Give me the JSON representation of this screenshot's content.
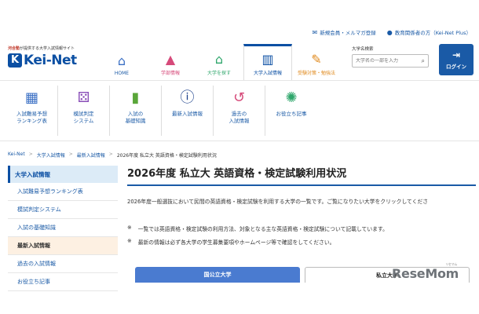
{
  "top_links": {
    "register": "新規会員・メルマガ登録",
    "staff": "教育関係者の方（Kei-Net Plus）"
  },
  "logo": {
    "tagline_brand": "河合塾",
    "tagline_rest": "が提供する大学入試情報サイト",
    "name": "Kei-Net",
    "mark": "K"
  },
  "main_nav": [
    {
      "label": "HOME",
      "icon": "home-icon",
      "color": "#3a6fc4"
    },
    {
      "label": "学部情報",
      "icon": "graduation-cap-icon",
      "color": "#d64a7a"
    },
    {
      "label": "大学を探す",
      "icon": "school-search-icon",
      "color": "#2ea66b"
    },
    {
      "label": "大学入試情報",
      "icon": "bar-chart-icon",
      "color": "#0b4fa3"
    },
    {
      "label": "受験対策・勉強法",
      "icon": "pencil-icon",
      "color": "#e08a1e"
    }
  ],
  "search": {
    "caption": "大学名検索",
    "placeholder": "大学名の一部を入力"
  },
  "login": {
    "label": "ログイン"
  },
  "sub_nav": [
    {
      "label": "入試難易予想\nランキング表",
      "icon": "table-icon",
      "color": "#3a6fc4"
    },
    {
      "label": "模試判定\nシステム",
      "icon": "dice-icon",
      "color": "#8a4fb8"
    },
    {
      "label": "入試の\n基礎知識",
      "icon": "book-icon",
      "color": "#5aa63a"
    },
    {
      "label": "最新入試情報",
      "icon": "info-icon",
      "color": "#1a3f8a"
    },
    {
      "label": "過去の\n入試情報",
      "icon": "history-icon",
      "color": "#d64a7a"
    },
    {
      "label": "お役立ち記事",
      "icon": "lightbulb-icon",
      "color": "#2ea66b"
    }
  ],
  "breadcrumb": [
    "Kei-Net",
    "大学入試情報",
    "最新入試情報",
    "2026年度 私立大 英語資格・検定試験利用状況"
  ],
  "sidebar": {
    "heading": "大学入試情報",
    "items": [
      "入試難易予想ランキング表",
      "模試判定システム",
      "入試の基礎知識",
      "最新入試情報",
      "過去の入試情報",
      "お役立ち記事"
    ]
  },
  "main": {
    "title": "2026年度 私立大 英語資格・検定試験利用状況",
    "description": "2026年度一般選抜において民間の英語資格・検定試験を利用する大学の一覧です。ご覧になりたい大学をクリックしてくださ",
    "note_mark": "※",
    "note1": "一覧では英語資格・検定試験の利用方法、対象となる主な英語資格・検定試験について記載しています。",
    "note2": "最新の情報は必ず各大学の学生募集要項やホームページ等で確認をしてください。",
    "tabs": [
      "国公立大学",
      "私立大学"
    ]
  },
  "watermark": {
    "text": "ReseMom",
    "small": "リセマム"
  }
}
